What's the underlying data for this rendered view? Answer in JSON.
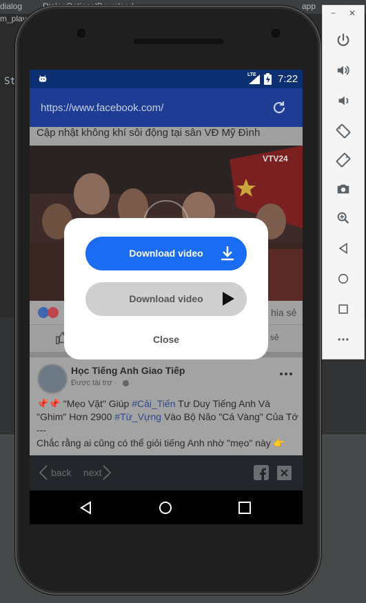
{
  "ide": {
    "tab1": "dialog",
    "tab2": "DialogOptionalDownload",
    "tab3": "m_play_vid",
    "tab_right": "app",
    "code_snippet": "St"
  },
  "emulator_toolbar": {
    "minimize": "−",
    "close": "✕",
    "buttons": [
      "power-icon",
      "volume-up-icon",
      "volume-down-icon",
      "rotate-left-icon",
      "rotate-right-icon",
      "screenshot-icon",
      "zoom-icon",
      "back-icon",
      "home-icon",
      "overview-icon",
      "more-icon"
    ]
  },
  "status_bar": {
    "network": "LTE",
    "time": "7:22"
  },
  "browser": {
    "url": "https://www.facebook.com/"
  },
  "post1": {
    "title": "Cập nhật không khí sôi động tại sân VĐ Mỹ Đình",
    "video_watermark": "VTV24",
    "share_text": "hia sẻ",
    "share_text2": "sẻ"
  },
  "post2": {
    "author": "Học Tiếng Anh Giao Tiếp",
    "sponsored": "Được tài trợ · ",
    "line1_prefix": "\"Mẹo Vặt\" Giúp ",
    "line1_tag": "#Cải_Tiến",
    "line1_suffix": " Tư Duy Tiếng Anh Và",
    "line2_prefix": "\"Ghim\" Hơn 2900 ",
    "line2_tag": "#Từ_Vựng",
    "line2_suffix": " Vào Bộ Não \"Cá Vàng\" Của Tớ",
    "line3": "---",
    "line4": "Chắc rằng ai cũng có thể giỏi tiếng Anh nhờ \"mẹo\" này"
  },
  "web_nav": {
    "back": "back",
    "next": "next"
  },
  "dialog": {
    "download_primary": "Download video",
    "download_secondary": "Download video",
    "close": "Close"
  },
  "colors": {
    "primary_button": "#1a6df2",
    "secondary_button": "#cfcfcf",
    "status_bar": "#0c2f71",
    "url_bar": "#1e3c93"
  }
}
